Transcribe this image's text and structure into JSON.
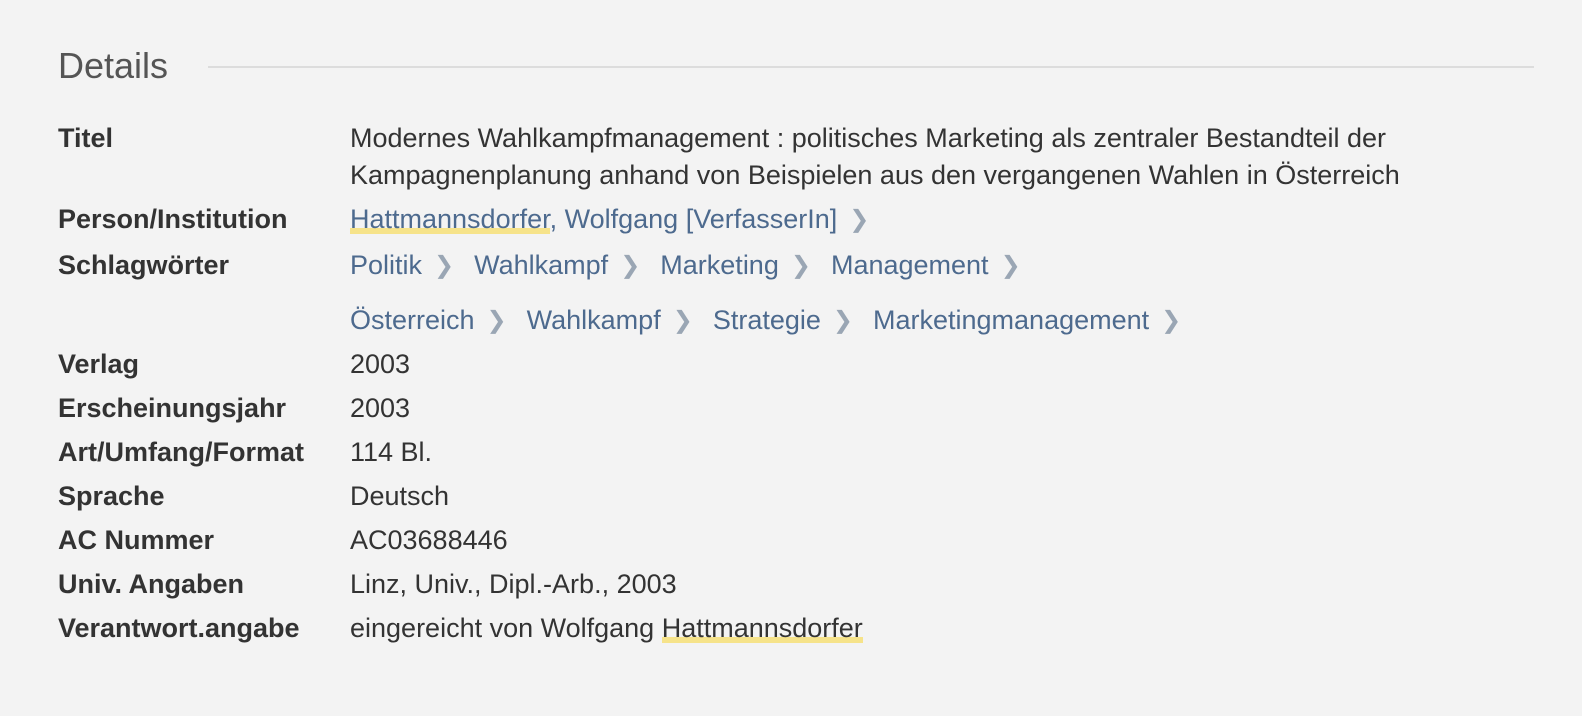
{
  "section": {
    "title": "Details"
  },
  "fields": {
    "title": {
      "label": "Titel",
      "line1": "Modernes Wahlkampfmanagement : politisches Marketing als zentraler Bestandteil der",
      "line2": "Kampagnenplanung anhand von Beispielen aus den vergangenen Wahlen in Österreich"
    },
    "person": {
      "label": "Person/Institution",
      "lastname": "Hattmannsdorfer",
      "rest": ", Wolfgang [VerfasserIn]"
    },
    "keywords": {
      "label": "Schlagwörter",
      "chain1": [
        "Politik",
        "Wahlkampf",
        "Marketing",
        "Management"
      ],
      "chain2": [
        "Österreich",
        "Wahlkampf",
        "Strategie",
        "Marketingmanagement"
      ]
    },
    "publisher": {
      "label": "Verlag",
      "value": "2003"
    },
    "year": {
      "label": "Erscheinungsjahr",
      "value": "2003"
    },
    "extent": {
      "label": "Art/Umfang/Format",
      "value": "114 Bl."
    },
    "language": {
      "label": "Sprache",
      "value": "Deutsch"
    },
    "ac_number": {
      "label": "AC Nummer",
      "value": "AC03688446"
    },
    "univ": {
      "label": "Univ. Angaben",
      "value": "Linz, Univ., Dipl.-Arb., 2003"
    },
    "responsibility": {
      "label": "Verantwort.angabe",
      "prefix": "eingereicht von Wolfgang ",
      "highlight": "Hattmannsdorfer"
    }
  },
  "colors": {
    "background": "#f3f3f3",
    "link": "#4d6a8e",
    "highlight": "#f6e38a",
    "chevron": "#9aa6b4"
  },
  "icons": {
    "chevron": "chevron-right-icon"
  }
}
